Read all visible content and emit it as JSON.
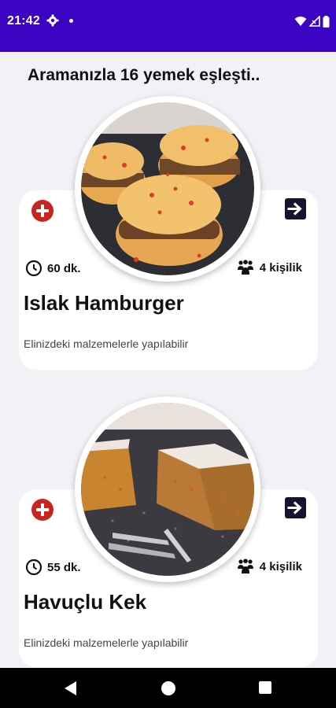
{
  "status_bar": {
    "time": "21:42",
    "colors": {
      "background": "#3a04c2"
    }
  },
  "search_header": "Aramanızla 16 yemek eşleşti..",
  "recipes": [
    {
      "title": "Islak Hamburger",
      "duration": "60 dk.",
      "servings": "4 kişilik",
      "note": "Elinizdeki malzemelerle yapılabilir"
    },
    {
      "title": "Havuçlu Kek",
      "duration": "55 dk.",
      "servings": "4 kişilik",
      "note": "Elinizdeki malzemelerle yapılabilir"
    }
  ],
  "colors": {
    "accent_red": "#c8251e",
    "arrow_button": "#14142c",
    "page_background": "#f1f1f6"
  },
  "icons": [
    "gear-icon",
    "wifi-icon",
    "signal-icon",
    "battery-icon",
    "add-circle-icon",
    "arrow-right-icon",
    "clock-icon",
    "people-icon",
    "back-icon",
    "home-icon",
    "recents-icon"
  ]
}
